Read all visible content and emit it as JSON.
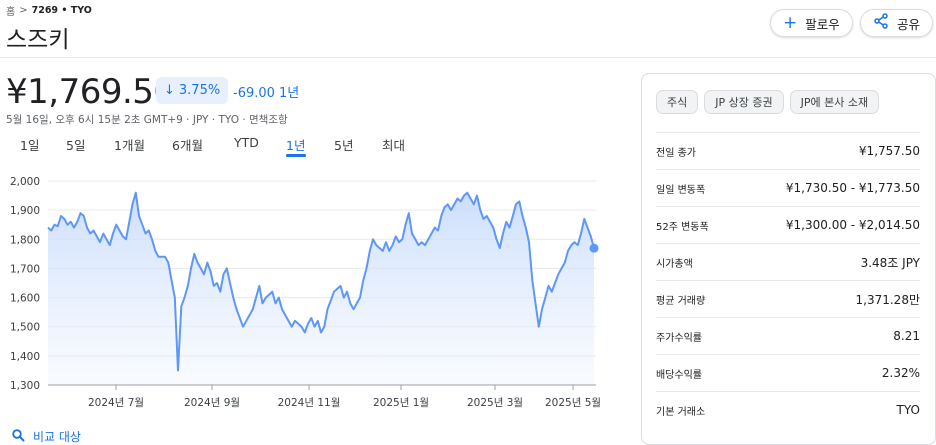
{
  "breadcrumb": {
    "home": "홈",
    "ticker": "7269 • TYO"
  },
  "company": {
    "name": "스즈키"
  },
  "actions": {
    "follow_label": "팔로우",
    "share_label": "공유"
  },
  "quote": {
    "price": "¥1,769.50",
    "change_pct": "3.75%",
    "change_abs": "-69.00 1년",
    "meta": "5월 16일, 오후 6시 15분 2초 GMT+9 · JPY · TYO · 면책조항"
  },
  "range_tabs": [
    "1일",
    "5일",
    "1개월",
    "6개월",
    "YTD",
    "1년",
    "5년",
    "최대"
  ],
  "active_tab": "1년",
  "compare_label": "비교 대상",
  "colors": {
    "accent": "#1a73e8",
    "line": "#5e97f6",
    "fill": "#e8f0fe"
  },
  "chart_data": {
    "type": "area",
    "x_tick_labels": [
      "2024년 7월",
      "2024년 9월",
      "2024년 11월",
      "2025년 1월",
      "2025년 3월",
      "2025년 5월"
    ],
    "y_tick_labels": [
      "2,000",
      "1,900",
      "1,800",
      "1,700",
      "1,600",
      "1,500",
      "1,400",
      "1,300"
    ],
    "ylim": [
      1300,
      2000
    ],
    "grid": true,
    "series": [
      {
        "values": [
          1840,
          1830,
          1850,
          1845,
          1880,
          1870,
          1850,
          1860,
          1840,
          1860,
          1890,
          1880,
          1840,
          1820,
          1830,
          1810,
          1790,
          1820,
          1800,
          1780,
          1820,
          1850,
          1830,
          1810,
          1800,
          1860,
          1920,
          1960,
          1880,
          1850,
          1820,
          1830,
          1800,
          1760,
          1740,
          1740,
          1740,
          1720,
          1660,
          1600,
          1350,
          1570,
          1600,
          1640,
          1700,
          1750,
          1720,
          1700,
          1680,
          1720,
          1690,
          1640,
          1650,
          1620,
          1680,
          1700,
          1650,
          1600,
          1560,
          1530,
          1500,
          1520,
          1540,
          1560,
          1600,
          1640,
          1580,
          1600,
          1610,
          1620,
          1580,
          1600,
          1560,
          1540,
          1520,
          1500,
          1520,
          1510,
          1500,
          1480,
          1510,
          1530,
          1500,
          1520,
          1480,
          1500,
          1560,
          1590,
          1620,
          1630,
          1640,
          1600,
          1620,
          1580,
          1560,
          1580,
          1600,
          1660,
          1700,
          1760,
          1800,
          1780,
          1770,
          1760,
          1790,
          1760,
          1780,
          1810,
          1790,
          1800,
          1850,
          1890,
          1820,
          1800,
          1780,
          1790,
          1780,
          1800,
          1820,
          1840,
          1830,
          1880,
          1910,
          1920,
          1900,
          1920,
          1940,
          1930,
          1950,
          1960,
          1940,
          1920,
          1950,
          1900,
          1870,
          1880,
          1860,
          1840,
          1800,
          1770,
          1820,
          1860,
          1840,
          1880,
          1920,
          1930,
          1880,
          1840,
          1790,
          1660,
          1580,
          1500,
          1560,
          1600,
          1640,
          1620,
          1650,
          1680,
          1700,
          1720,
          1760,
          1780,
          1790,
          1780,
          1820,
          1870,
          1840,
          1810,
          1769.5
        ]
      }
    ],
    "last_value": 1769.5
  },
  "stats": {
    "chips": [
      "주식",
      "JP 상장 증권",
      "JP에 본사 소재"
    ],
    "rows": [
      {
        "label": "전일 종가",
        "value": "¥1,757.50"
      },
      {
        "label": "일일 변동폭",
        "value": "¥1,730.50 - ¥1,773.50"
      },
      {
        "label": "52주 변동폭",
        "value": "¥1,300.00 - ¥2,014.50"
      },
      {
        "label": "시가총액",
        "value": "3.48조 JPY"
      },
      {
        "label": "평균 거래량",
        "value": "1,371.28만"
      },
      {
        "label": "주가수익률",
        "value": "8.21"
      },
      {
        "label": "배당수익률",
        "value": "2.32%"
      },
      {
        "label": "기본 거래소",
        "value": "TYO"
      }
    ]
  }
}
